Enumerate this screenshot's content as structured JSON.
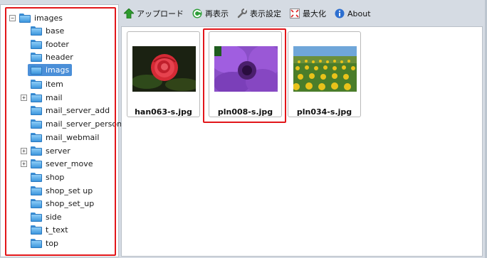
{
  "toolbar": {
    "upload": "アップロード",
    "refresh": "再表示",
    "settings": "表示設定",
    "maximize": "最大化",
    "about": "About"
  },
  "tree": {
    "root": "images",
    "items": [
      {
        "label": "base",
        "expandable": false
      },
      {
        "label": "footer",
        "expandable": false
      },
      {
        "label": "header",
        "expandable": false
      },
      {
        "label": "imags",
        "expandable": false,
        "selected": true
      },
      {
        "label": "item",
        "expandable": false
      },
      {
        "label": "mail",
        "expandable": true
      },
      {
        "label": "mail_server_add",
        "expandable": false
      },
      {
        "label": "mail_server_personal",
        "expandable": false
      },
      {
        "label": "mail_webmail",
        "expandable": false
      },
      {
        "label": "server",
        "expandable": true
      },
      {
        "label": "sever_move",
        "expandable": true
      },
      {
        "label": "shop",
        "expandable": false
      },
      {
        "label": "shop_set up",
        "expandable": false
      },
      {
        "label": "shop_set_up",
        "expandable": false
      },
      {
        "label": "side",
        "expandable": false
      },
      {
        "label": "t_text",
        "expandable": false
      },
      {
        "label": "top",
        "expandable": false
      }
    ]
  },
  "thumbnails": [
    {
      "name": "han063-s.jpg",
      "subject": "red rose"
    },
    {
      "name": "pln008-s.jpg",
      "subject": "purple anemone"
    },
    {
      "name": "pln034-s.jpg",
      "subject": "sunflower field"
    }
  ],
  "colors": {
    "highlight": "#e2161a",
    "selection": "#4b8fd8",
    "folder": "#3c96dd"
  }
}
